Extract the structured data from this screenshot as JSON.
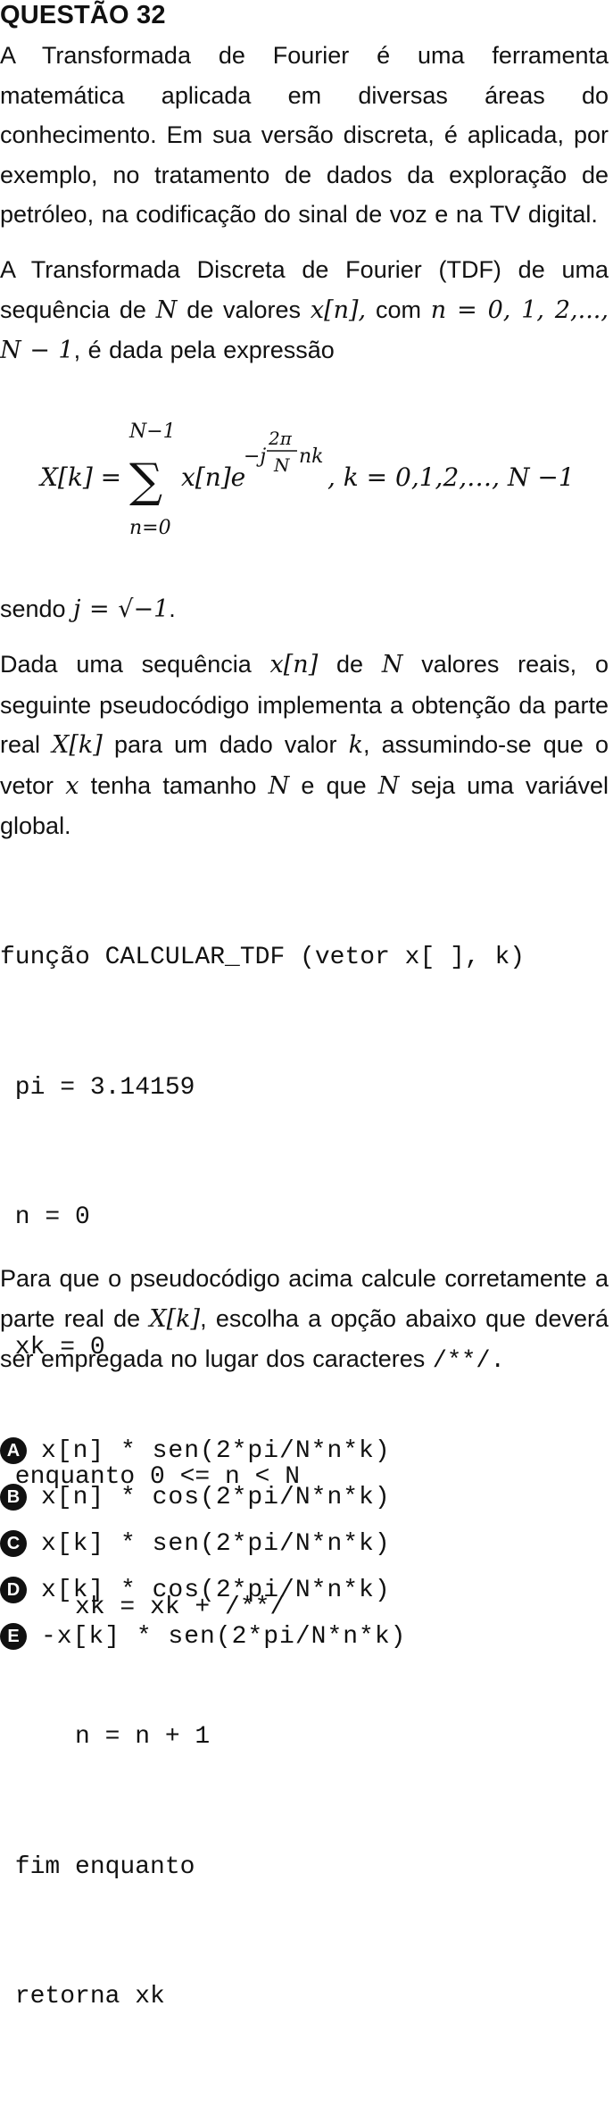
{
  "question": {
    "title": "QUESTÃO 32",
    "intro": "A Transformada de Fourier é uma ferramenta matemática aplicada em diversas áreas do conhecimento. Em sua versão discreta, é aplicada, por exemplo, no tratamento de dados da exploração de petróleo, na codificação do sinal de voz e na TV digital.",
    "tdf_p1": "A Transformada Discreta de Fourier (TDF) de uma sequência de",
    "tdf_N": "N",
    "tdf_p2": "de valores",
    "tdf_xn": "x[n],",
    "tdf_p3": "com",
    "tdf_range": "n = 0, 1, 2,..., N − 1",
    "tdf_p4": ", é dada pela expressão",
    "formula": {
      "lhs": "X[k] =",
      "sum_upper": "N−1",
      "sum_symbol": "∑",
      "sum_lower": "n=0",
      "term": "x[n]e",
      "exp_prefix": "−j",
      "exp_num": "2π",
      "exp_den": "N",
      "exp_suffix": "nk",
      "range": ", k = 0,1,2,…, N −1"
    },
    "sendo_text": "sendo",
    "sendo_math": "j = √−1",
    "sendo_end": ".",
    "desc_1": "Dada uma sequência",
    "desc_xn": "x[n]",
    "desc_2": "de",
    "desc_N1": "N",
    "desc_3": "valores reais, o seguinte pseudocódigo implementa a obtenção da parte real",
    "desc_Xk": "X[k]",
    "desc_4": "para um dado valor",
    "desc_k": "k",
    "desc_5": ", assumindo-se que o vetor",
    "desc_x": "x",
    "desc_6": "tenha tamanho",
    "desc_N2": "N",
    "desc_7": "e que",
    "desc_N3": "N",
    "desc_8": "seja uma variável global.",
    "code_lines": [
      "função CALCULAR_TDF (vetor x[ ], k)",
      " pi = 3.14159",
      " n = 0",
      " xk = 0",
      " enquanto 0 <= n < N",
      "     xk = xk + /**/",
      "     n = n + 1",
      " fim enquanto",
      " retorna xk"
    ],
    "final_1": "Para que o pseudocódigo acima calcule corretamente a parte real de",
    "final_Xk": "X[k]",
    "final_2": ", escolha a opção abaixo que deverá ser empregada no lugar dos caracteres",
    "final_chars": "/**/.",
    "options": [
      {
        "letter": "A",
        "text": "x[n] * sen(2*pi/N*n*k)"
      },
      {
        "letter": "B",
        "text": "x[n] * cos(2*pi/N*n*k)"
      },
      {
        "letter": "C",
        "text": "x[k] * sen(2*pi/N*n*k)"
      },
      {
        "letter": "D",
        "text": "x[k] * cos(2*pi/N*n*k)"
      },
      {
        "letter": "E",
        "text": "-x[k] * sen(2*pi/N*n*k)"
      }
    ]
  }
}
